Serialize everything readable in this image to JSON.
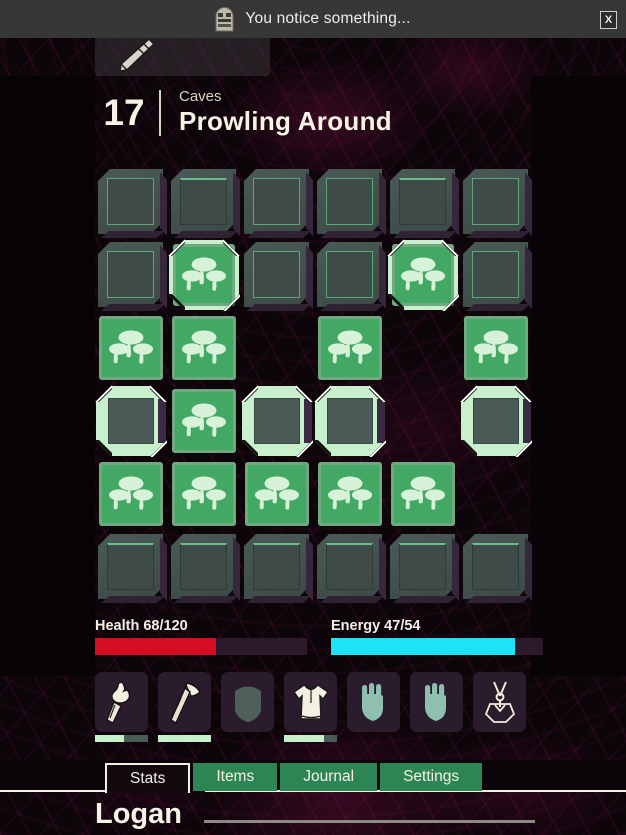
{
  "banner": {
    "icon": "tomb-icon",
    "message": "You notice something...",
    "close_label": "X"
  },
  "item_peek": {
    "icon": "dagger-icon"
  },
  "header": {
    "level": "17",
    "location": "Caves",
    "title": "Prowling Around"
  },
  "grid": {
    "columns": 6,
    "rows": 6,
    "tile_icon": "mushroom-icon",
    "cells": [
      [
        {
          "state": "dark",
          "edge": "all"
        },
        {
          "state": "dark",
          "edge": "top"
        },
        {
          "state": "dark",
          "edge": "all"
        },
        {
          "state": "dark",
          "edge": "all"
        },
        {
          "state": "dark",
          "edge": "top"
        },
        {
          "state": "dark",
          "edge": "all"
        }
      ],
      [
        {
          "state": "dark",
          "edge": "all"
        },
        {
          "state": "shroom",
          "glow": true
        },
        {
          "state": "dark",
          "edge": "all"
        },
        {
          "state": "dark",
          "edge": "all"
        },
        {
          "state": "shroom",
          "glow": true
        },
        {
          "state": "dark",
          "edge": "all"
        }
      ],
      [
        {
          "state": "shroom",
          "glow": false
        },
        {
          "state": "shroom",
          "glow": false
        },
        {
          "state": "void"
        },
        {
          "state": "shroom",
          "glow": false
        },
        {
          "state": "void"
        },
        {
          "state": "shroom",
          "glow": false
        }
      ],
      [
        {
          "state": "lit-empty"
        },
        {
          "state": "shroom",
          "glow": false
        },
        {
          "state": "lit-empty"
        },
        {
          "state": "lit-empty"
        },
        {
          "state": "void"
        },
        {
          "state": "lit-empty"
        }
      ],
      [
        {
          "state": "shroom",
          "glow": false
        },
        {
          "state": "shroom",
          "glow": false
        },
        {
          "state": "shroom",
          "glow": false
        },
        {
          "state": "shroom",
          "glow": false
        },
        {
          "state": "shroom",
          "glow": false
        },
        {
          "state": "void"
        }
      ],
      [
        {
          "state": "dark",
          "edge": "top"
        },
        {
          "state": "dark",
          "edge": "top"
        },
        {
          "state": "dark",
          "edge": "top"
        },
        {
          "state": "dark",
          "edge": "top"
        },
        {
          "state": "dark",
          "edge": "top"
        },
        {
          "state": "dark",
          "edge": "top"
        }
      ]
    ]
  },
  "stats": {
    "health": {
      "label": "Health 68/120",
      "current": 68,
      "max": 120,
      "percent": 57,
      "color": "#d50d24"
    },
    "energy": {
      "label": "Energy 47/54",
      "current": 47,
      "max": 54,
      "percent": 87,
      "color": "#1ee3f7"
    }
  },
  "equipment": {
    "slots": [
      {
        "name": "torch-slot",
        "icon": "torch-icon",
        "filled": true,
        "durability": 55
      },
      {
        "name": "axe-slot",
        "icon": "axe-icon",
        "filled": true,
        "durability": 100
      },
      {
        "name": "head-slot",
        "icon": "head-silhouette-icon",
        "filled": false,
        "durability": null
      },
      {
        "name": "shirt-slot",
        "icon": "shirt-icon",
        "filled": true,
        "durability": 75
      },
      {
        "name": "left-hand-slot",
        "icon": "hand-icon",
        "filled": false,
        "durability": null
      },
      {
        "name": "right-hand-slot",
        "icon": "hand-icon",
        "filled": false,
        "durability": null
      },
      {
        "name": "amulet-slot",
        "icon": "amulet-icon",
        "filled": true,
        "durability": null
      }
    ]
  },
  "tabs": {
    "active": "Stats",
    "items": [
      {
        "label": "Stats",
        "active": true
      },
      {
        "label": "Items",
        "active": false
      },
      {
        "label": "Journal",
        "active": false
      },
      {
        "label": "Settings",
        "active": false
      }
    ]
  },
  "character": {
    "name": "Logan"
  },
  "colors": {
    "accent_green": "#43a864",
    "tile_glow": "#c8f0cd",
    "tab_green": "#2d8554",
    "parchment": "#f6f2e4",
    "health_red": "#d50d24",
    "energy_cyan": "#1ee3f7"
  }
}
